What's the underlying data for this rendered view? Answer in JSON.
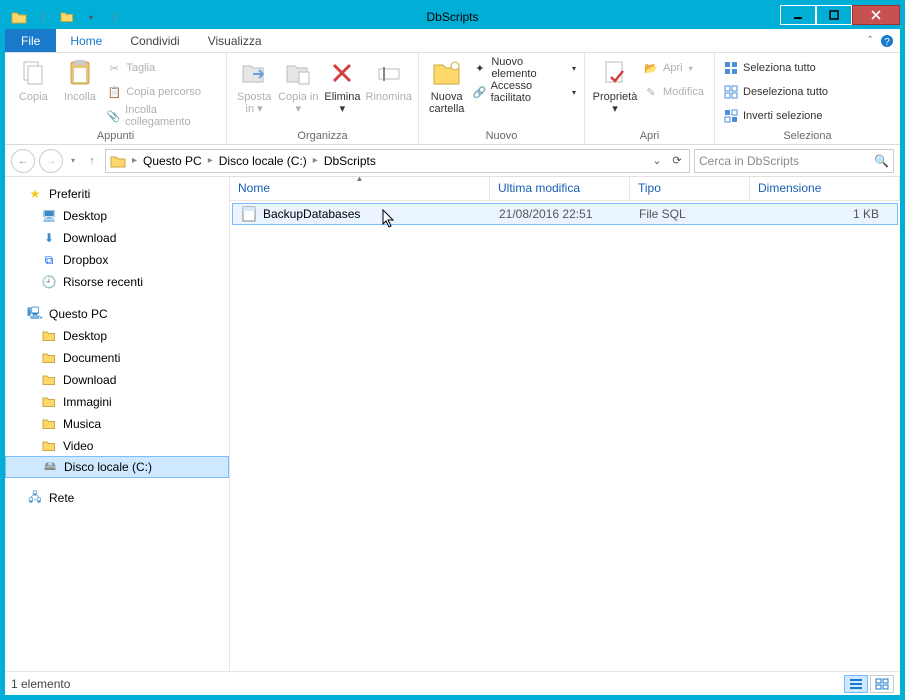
{
  "title": "DbScripts",
  "menu": {
    "file": "File",
    "tabs": [
      "Home",
      "Condividi",
      "Visualizza"
    ],
    "active": 0
  },
  "ribbon": {
    "appunti": {
      "label": "Appunti",
      "copia": "Copia",
      "incolla": "Incolla",
      "taglia": "Taglia",
      "copia_percorso": "Copia percorso",
      "incolla_collegamento": "Incolla collegamento"
    },
    "organizza": {
      "label": "Organizza",
      "sposta": "Sposta in",
      "copia": "Copia in",
      "elimina": "Elimina",
      "rinomina": "Rinomina"
    },
    "nuovo": {
      "label": "Nuovo",
      "cartella": "Nuova cartella",
      "nuovo_elemento": "Nuovo elemento",
      "accesso": "Accesso facilitato"
    },
    "apri": {
      "label": "Apri",
      "proprieta": "Proprietà",
      "apri": "Apri",
      "modifica": "Modifica"
    },
    "seleziona": {
      "label": "Seleziona",
      "tutto": "Seleziona tutto",
      "deseleziona": "Deseleziona tutto",
      "inverti": "Inverti selezione"
    }
  },
  "breadcrumbs": [
    "Questo PC",
    "Disco locale (C:)",
    "DbScripts"
  ],
  "search_placeholder": "Cerca in DbScripts",
  "nav": {
    "preferiti": {
      "label": "Preferiti",
      "items": [
        "Desktop",
        "Download",
        "Dropbox",
        "Risorse recenti"
      ]
    },
    "pc": {
      "label": "Questo PC",
      "items": [
        "Desktop",
        "Documenti",
        "Download",
        "Immagini",
        "Musica",
        "Video",
        "Disco locale (C:)"
      ]
    },
    "rete": {
      "label": "Rete"
    }
  },
  "columns": {
    "name": "Nome",
    "modified": "Ultima modifica",
    "type": "Tipo",
    "size": "Dimensione"
  },
  "rows": [
    {
      "name": "BackupDatabases",
      "modified": "21/08/2016 22:51",
      "type": "File SQL",
      "size": "1 KB"
    }
  ],
  "status": "1 elemento"
}
